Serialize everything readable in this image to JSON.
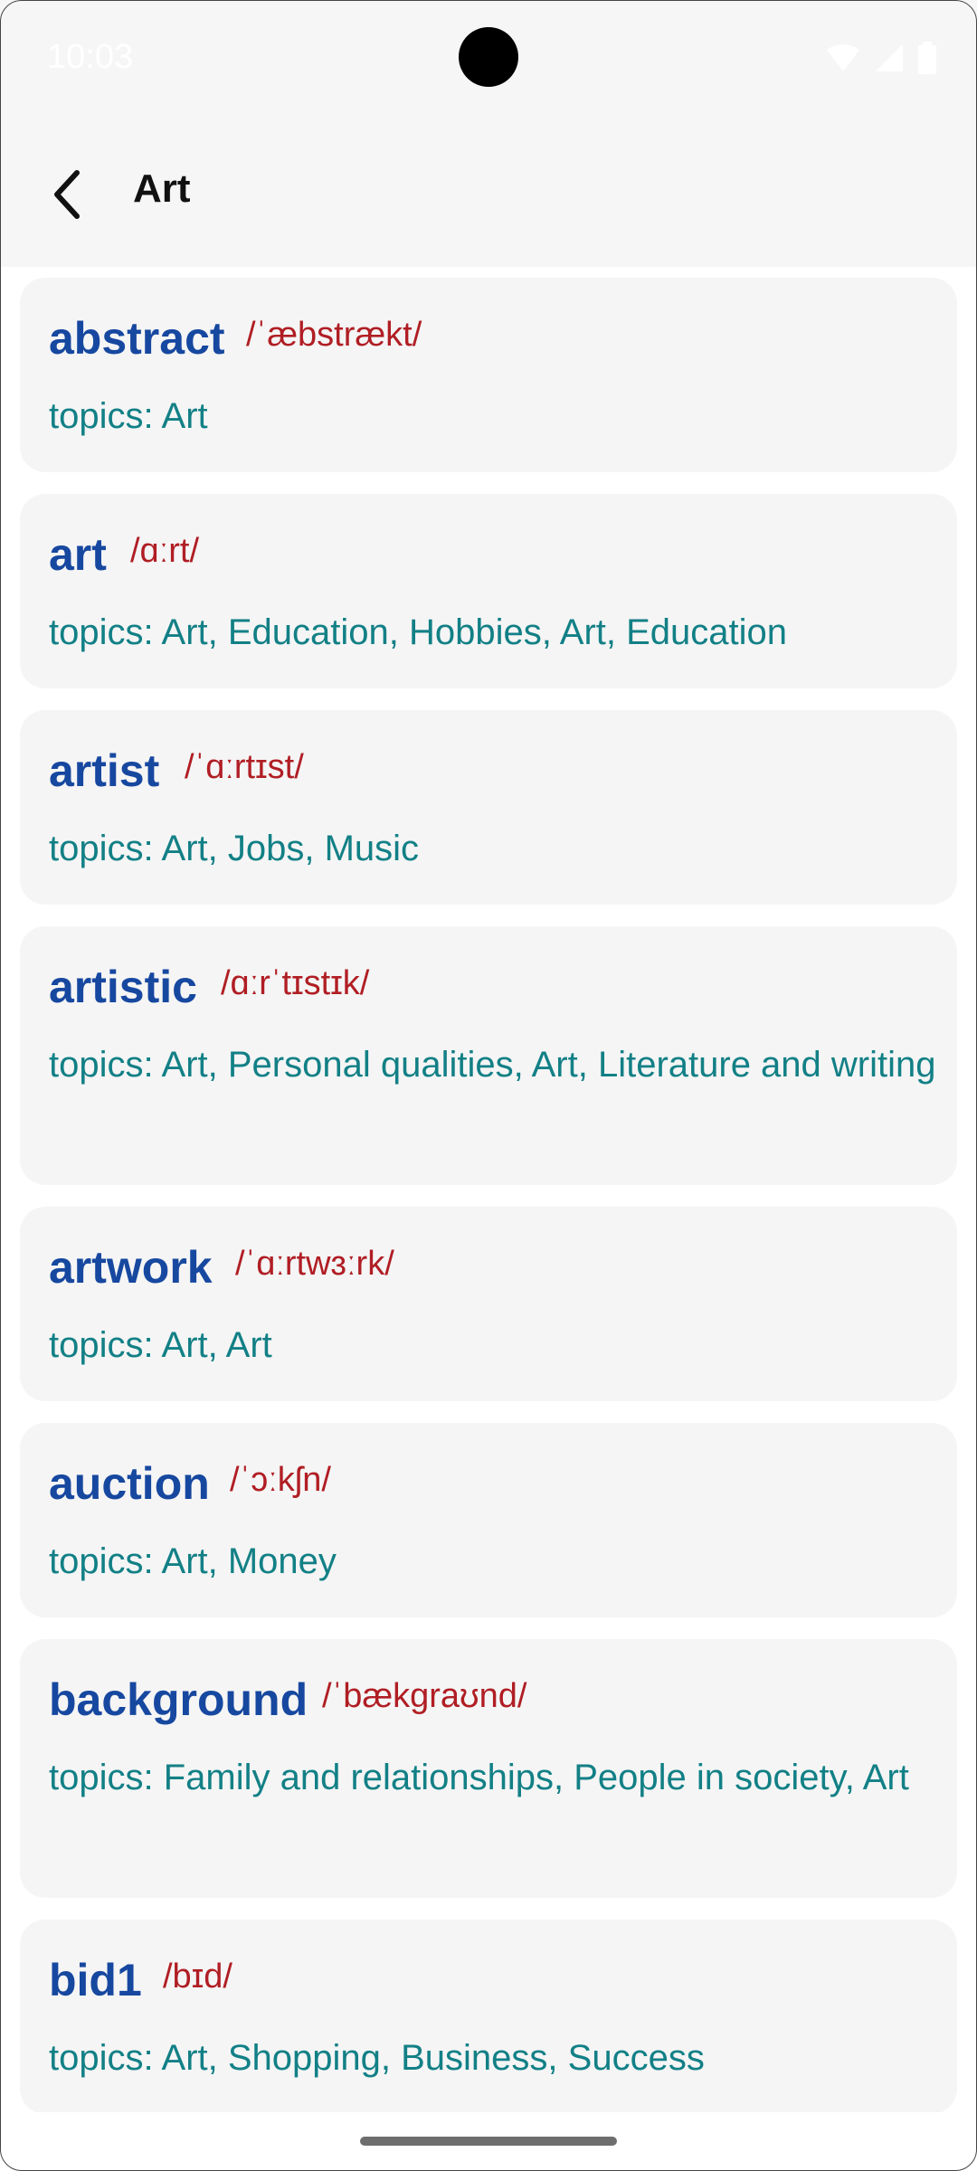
{
  "status": {
    "time": "10:03"
  },
  "header": {
    "title": "Art",
    "back_icon": "chevron-left-icon"
  },
  "colors": {
    "headword": "#1748a0",
    "pronunciation": "#b01e24",
    "topics": "#128086",
    "card": "#f5f5f5"
  },
  "entries": [
    {
      "word": "abstract",
      "pron": "/ˈæbstrækt/",
      "topics": "topics: Art"
    },
    {
      "word": "art",
      "pron": "/ɑːrt/",
      "topics": "topics: Art, Education, Hobbies, Art, Education"
    },
    {
      "word": "artist",
      "pron": "/ˈɑːrtɪst/",
      "topics": "topics: Art, Jobs, Music"
    },
    {
      "word": "artistic",
      "pron": "/ɑːrˈtɪstɪk/",
      "topics": "topics: Art, Personal qualities, Art, Literature and writing"
    },
    {
      "word": "artwork",
      "pron": "/ˈɑːrtwɜːrk/",
      "topics": "topics: Art, Art"
    },
    {
      "word": "auction",
      "pron": "/ˈɔːkʃn/",
      "topics": "topics: Art, Money"
    },
    {
      "word": "background",
      "pron": "/ˈbækɡraʊnd/",
      "topics": "topics: Family and relationships, People in society, Art"
    },
    {
      "word": "bid1",
      "pron": "/bɪd/",
      "topics": "topics: Art, Shopping, Business, Success"
    }
  ]
}
